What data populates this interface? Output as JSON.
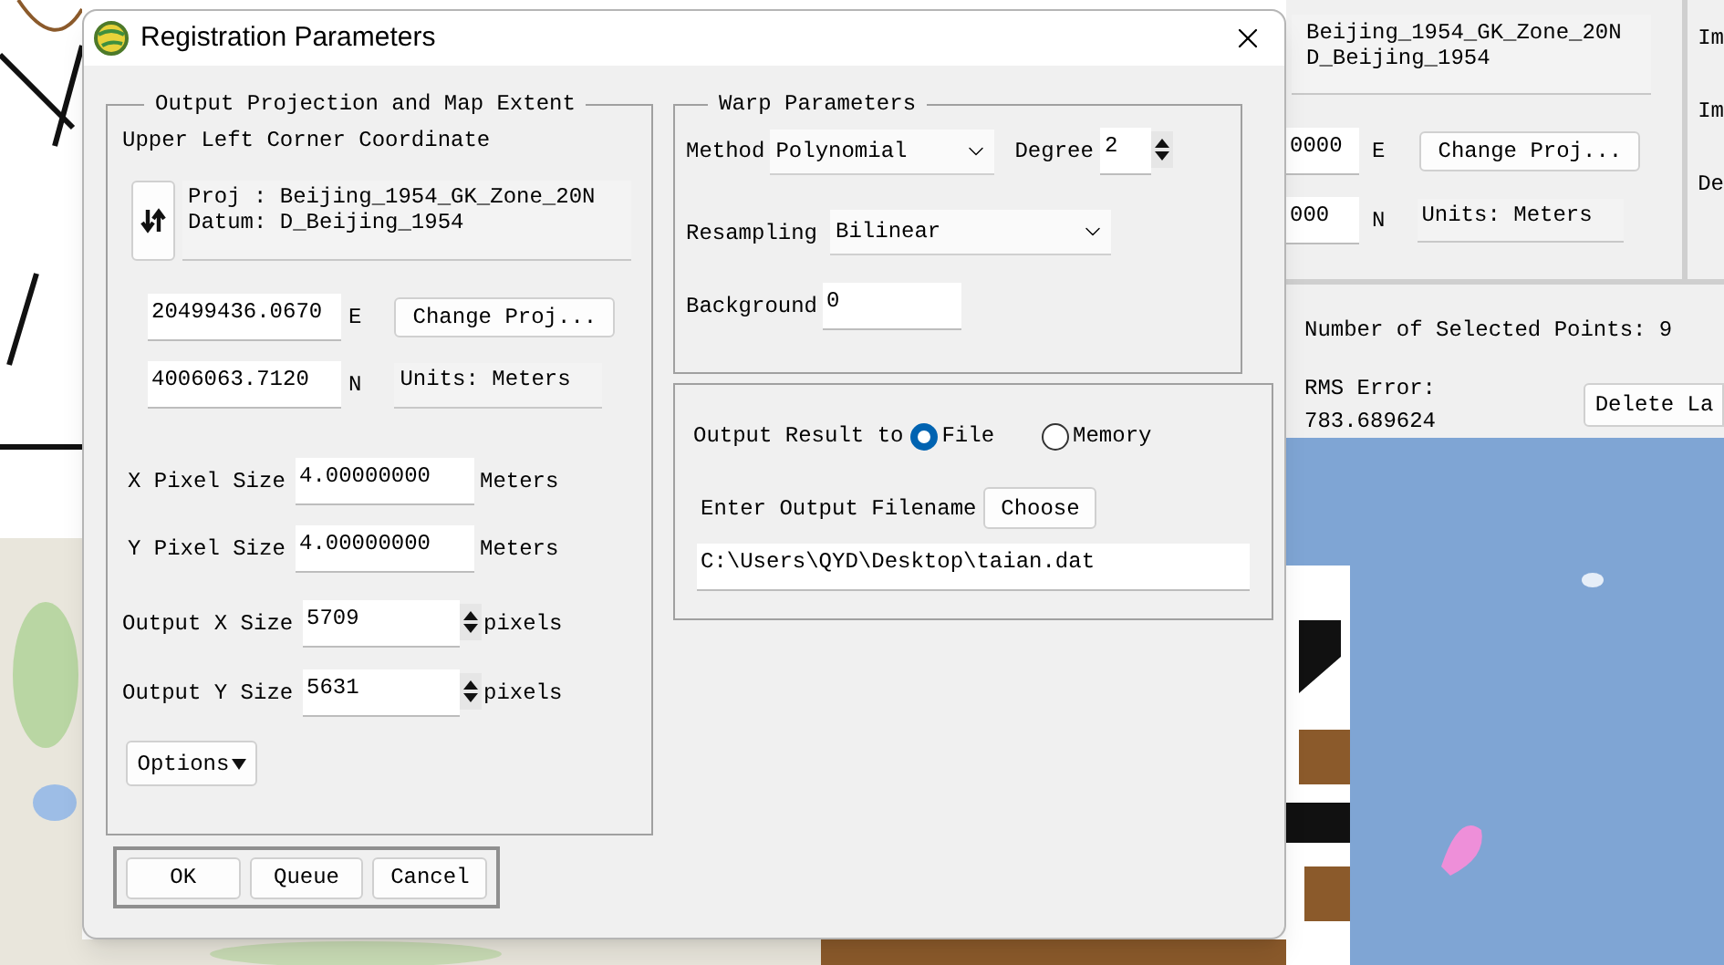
{
  "background_window": {
    "projection": [
      "Beijing_1954_GK_Zone_20N",
      "D_Beijing_1954"
    ],
    "easting": {
      "value": "0000",
      "unit": "E"
    },
    "northing": {
      "value": "000",
      "unit": "N"
    },
    "change_proj_button": "Change Proj...",
    "units": "Units: Meters",
    "side_labels": [
      "Im",
      "Im",
      "De"
    ],
    "selected_points": "Number of Selected Points: 9",
    "rms_error": "RMS Error: 783.689624",
    "delete_button": "Delete La"
  },
  "dialog": {
    "title": "Registration Parameters",
    "output_projection": {
      "title": "Output Projection and Map Extent",
      "subtitle": "Upper Left Corner Coordinate",
      "projection": [
        "Proj : Beijing_1954_GK_Zone_20N",
        "Datum: D_Beijing_1954"
      ],
      "easting": {
        "value": "20499436.0670",
        "unit": "E"
      },
      "northing": {
        "value": "4006063.7120",
        "unit": "N"
      },
      "change_proj_button": "Change Proj...",
      "units": "Units: Meters",
      "pixel_sizes": [
        {
          "label": "X Pixel Size",
          "value": "4.00000000",
          "unit": "Meters"
        },
        {
          "label": "Y Pixel Size",
          "value": "4.00000000",
          "unit": "Meters"
        }
      ],
      "output_sizes": [
        {
          "label": "Output X Size",
          "value": "5709",
          "unit": "pixels"
        },
        {
          "label": "Output Y Size",
          "value": "5631",
          "unit": "pixels"
        }
      ],
      "options_button": "Options"
    },
    "buttons": [
      "OK",
      "Queue",
      "Cancel"
    ],
    "warp_parameters": {
      "title": "Warp Parameters",
      "method": {
        "label": "Method",
        "value": "Polynomial"
      },
      "degree": {
        "label": "Degree",
        "value": "2"
      },
      "resampling": {
        "label": "Resampling",
        "value": "Bilinear"
      },
      "background": {
        "label": "Background",
        "value": "0"
      }
    },
    "output": {
      "label": "Output Result to",
      "options": [
        {
          "label": "File",
          "selected": true
        },
        {
          "label": "Memory",
          "selected": false
        }
      ],
      "filename_label": "Enter Output Filename",
      "choose_button": "Choose",
      "filename": "C:\\Users\\QYD\\Desktop\\taian.dat"
    }
  }
}
